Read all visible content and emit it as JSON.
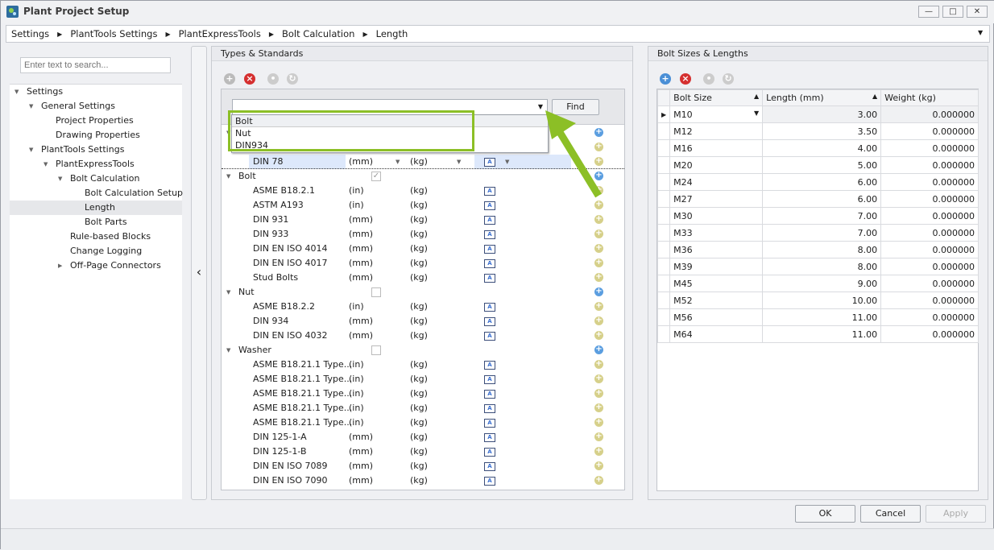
{
  "window": {
    "title": "Plant Project Setup",
    "minimize": "—",
    "maximize": "□",
    "close": "✕"
  },
  "breadcrumb": [
    "Settings",
    "PlantTools Settings",
    "PlantExpressTools",
    "Bolt Calculation",
    "Length"
  ],
  "left": {
    "search_placeholder": "Enter text to search...",
    "tree": [
      {
        "label": "Settings",
        "level": 0,
        "expanded": true
      },
      {
        "label": "General Settings",
        "level": 1,
        "expanded": true
      },
      {
        "label": "Project Properties",
        "level": 2
      },
      {
        "label": "Drawing Properties",
        "level": 2
      },
      {
        "label": "PlantTools Settings",
        "level": 1,
        "expanded": true
      },
      {
        "label": "PlantExpressTools",
        "level": 2,
        "expanded": true
      },
      {
        "label": "Bolt Calculation",
        "level": 3,
        "expanded": true
      },
      {
        "label": "Bolt Calculation Setup",
        "level": 4
      },
      {
        "label": "Length",
        "level": 4,
        "selected": true
      },
      {
        "label": "Bolt Parts",
        "level": 4
      },
      {
        "label": "Rule-based Blocks",
        "level": 3
      },
      {
        "label": "Change Logging",
        "level": 3
      },
      {
        "label": "Off-Page Connectors",
        "level": 3,
        "collapsed": true
      }
    ]
  },
  "middle": {
    "title": "Types & Standards",
    "find_label": "Find",
    "combo_value": "",
    "dropdown_options": [
      "Bolt",
      "Nut",
      "DIN934"
    ],
    "rows": [
      {
        "type": "group",
        "label": ""
      },
      {
        "type": "item",
        "label": ""
      },
      {
        "type": "item",
        "label": "DIN 78",
        "unit": "(mm)",
        "weight": "(kg)",
        "selected": true
      },
      {
        "type": "group",
        "label": "Bolt",
        "checked": true
      },
      {
        "type": "item",
        "label": "ASME B18.2.1",
        "unit": "(in)",
        "weight": "(kg)"
      },
      {
        "type": "item",
        "label": "ASTM A193",
        "unit": "(in)",
        "weight": "(kg)"
      },
      {
        "type": "item",
        "label": "DIN 931",
        "unit": "(mm)",
        "weight": "(kg)"
      },
      {
        "type": "item",
        "label": "DIN 933",
        "unit": "(mm)",
        "weight": "(kg)"
      },
      {
        "type": "item",
        "label": "DIN EN ISO 4014",
        "unit": "(mm)",
        "weight": "(kg)"
      },
      {
        "type": "item",
        "label": "DIN EN ISO 4017",
        "unit": "(mm)",
        "weight": "(kg)"
      },
      {
        "type": "item",
        "label": "Stud Bolts",
        "unit": "(mm)",
        "weight": "(kg)"
      },
      {
        "type": "group",
        "label": "Nut",
        "checked": false
      },
      {
        "type": "item",
        "label": "ASME B18.2.2",
        "unit": "(in)",
        "weight": "(kg)"
      },
      {
        "type": "item",
        "label": "DIN 934",
        "unit": "(mm)",
        "weight": "(kg)"
      },
      {
        "type": "item",
        "label": "DIN EN ISO 4032",
        "unit": "(mm)",
        "weight": "(kg)"
      },
      {
        "type": "group",
        "label": "Washer",
        "checked": false
      },
      {
        "type": "item",
        "label": "ASME B18.21.1 Type...",
        "unit": "(in)",
        "weight": "(kg)"
      },
      {
        "type": "item",
        "label": "ASME B18.21.1 Type...",
        "unit": "(in)",
        "weight": "(kg)"
      },
      {
        "type": "item",
        "label": "ASME B18.21.1 Type...",
        "unit": "(in)",
        "weight": "(kg)"
      },
      {
        "type": "item",
        "label": "ASME B18.21.1 Type...",
        "unit": "(in)",
        "weight": "(kg)"
      },
      {
        "type": "item",
        "label": "ASME B18.21.1 Type...",
        "unit": "(in)",
        "weight": "(kg)"
      },
      {
        "type": "item",
        "label": "DIN 125-1-A",
        "unit": "(mm)",
        "weight": "(kg)"
      },
      {
        "type": "item",
        "label": "DIN 125-1-B",
        "unit": "(mm)",
        "weight": "(kg)"
      },
      {
        "type": "item",
        "label": "DIN EN ISO 7089",
        "unit": "(mm)",
        "weight": "(kg)"
      },
      {
        "type": "item",
        "label": "DIN EN ISO 7090",
        "unit": "(mm)",
        "weight": "(kg)"
      }
    ]
  },
  "right": {
    "title": "Bolt Sizes & Lengths",
    "columns": [
      "Bolt Size",
      "Length (mm)",
      "Weight (kg)"
    ],
    "rows": [
      [
        "M10",
        "3.00",
        "0.000000"
      ],
      [
        "M12",
        "3.50",
        "0.000000"
      ],
      [
        "M16",
        "4.00",
        "0.000000"
      ],
      [
        "M20",
        "5.00",
        "0.000000"
      ],
      [
        "M24",
        "6.00",
        "0.000000"
      ],
      [
        "M27",
        "6.00",
        "0.000000"
      ],
      [
        "M30",
        "7.00",
        "0.000000"
      ],
      [
        "M33",
        "7.00",
        "0.000000"
      ],
      [
        "M36",
        "8.00",
        "0.000000"
      ],
      [
        "M39",
        "8.00",
        "0.000000"
      ],
      [
        "M45",
        "9.00",
        "0.000000"
      ],
      [
        "M52",
        "10.00",
        "0.000000"
      ],
      [
        "M56",
        "11.00",
        "0.000000"
      ],
      [
        "M64",
        "11.00",
        "0.000000"
      ]
    ]
  },
  "footer": {
    "ok": "OK",
    "cancel": "Cancel",
    "apply": "Apply"
  },
  "colors": {
    "highlight": "#8cbf26",
    "selected_row": "#dde8fb"
  }
}
